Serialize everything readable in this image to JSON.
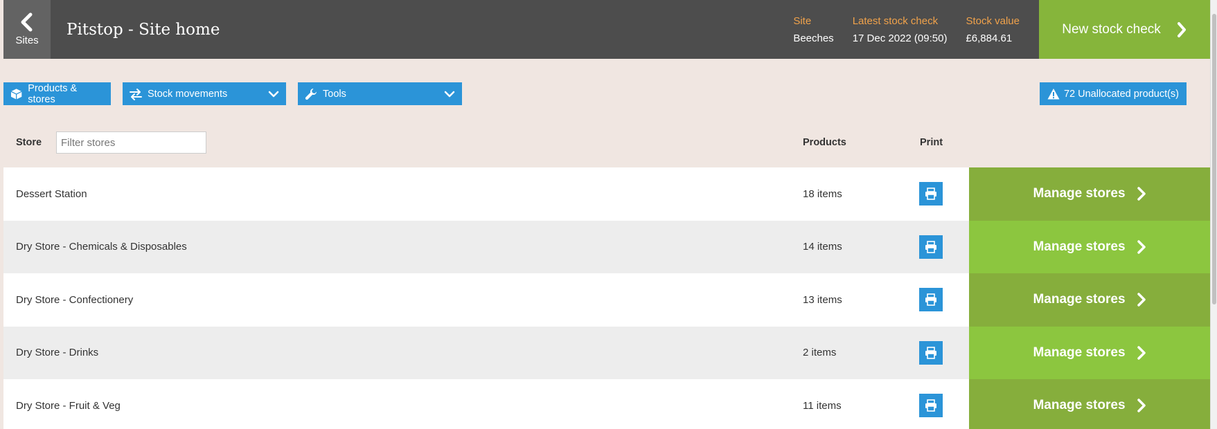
{
  "header": {
    "back_label": "Sites",
    "title": "Pitstop - Site home",
    "stats": [
      {
        "label": "Site",
        "value": "Beeches"
      },
      {
        "label": "Latest stock check",
        "value": "17 Dec 2022 (09:50)"
      },
      {
        "label": "Stock value",
        "value": "£6,884.61"
      }
    ],
    "new_check_label": "New stock check"
  },
  "toolbar": {
    "products_label": "Products & stores",
    "movements_label": "Stock movements",
    "tools_label": "Tools",
    "unallocated_label": "72 Unallocated product(s)"
  },
  "table": {
    "store_header": "Store",
    "filter_placeholder": "Filter stores",
    "products_header": "Products",
    "print_header": "Print",
    "rows": [
      {
        "name": "Dessert Station",
        "count": "18 items",
        "action": "Manage stores"
      },
      {
        "name": "Dry Store - Chemicals & Disposables",
        "count": "14 items",
        "action": "Manage stores"
      },
      {
        "name": "Dry Store - Confectionery",
        "count": "13 items",
        "action": "Manage stores"
      },
      {
        "name": "Dry Store - Drinks",
        "count": "2 items",
        "action": "Manage stores"
      },
      {
        "name": "Dry Store - Fruit & Veg",
        "count": "11 items",
        "action": "Manage stores"
      }
    ]
  },
  "colors": {
    "header_bg": "#4d4d4d",
    "accent_orange": "#f0a24b",
    "primary_blue": "#2b94d8",
    "green_dark": "#86ae3c",
    "green_light": "#8cc63f",
    "page_bg": "#f0e6e1"
  },
  "icons": {
    "back": "chevron-left-icon",
    "new_check": "chevron-right-icon",
    "products": "box-icon",
    "movements": "arrows-exchange-icon",
    "tools": "wrench-icon",
    "unallocated": "warning-icon",
    "print": "printer-icon",
    "manage": "chevron-right-icon"
  }
}
